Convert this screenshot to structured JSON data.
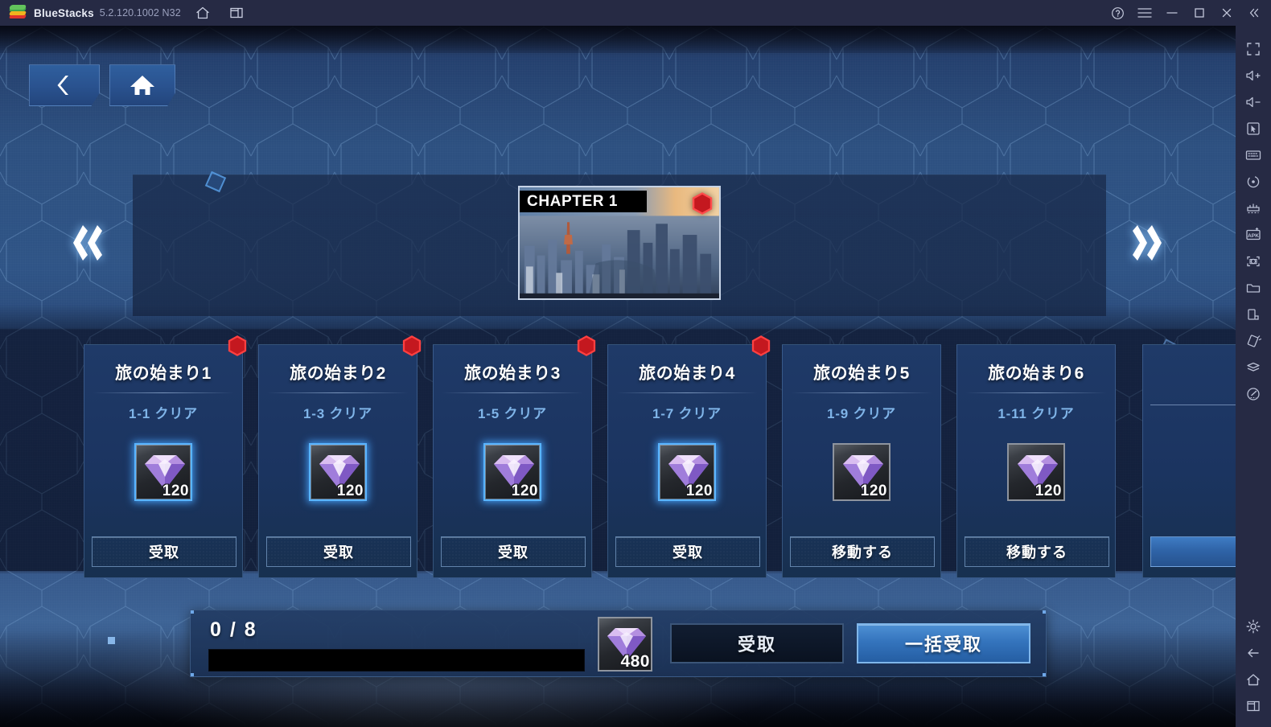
{
  "titlebar": {
    "app_name": "BlueStacks",
    "version": "5.2.120.1002 N32",
    "icons": [
      "bluestacks-logo",
      "home-icon",
      "multi-instance-icon"
    ],
    "right_buttons": [
      "help-icon",
      "menu-icon",
      "minimize-icon",
      "maximize-icon",
      "close-icon",
      "collapse-icon"
    ]
  },
  "sidebar": {
    "top_icons": [
      "fullscreen-icon",
      "volume-up-icon",
      "volume-down-icon",
      "pointer-icon",
      "keyboard-icon",
      "rotate-icon",
      "macro-icon",
      "install-apk-icon",
      "screenshot-icon",
      "media-folder-icon",
      "instance-icon",
      "shake-icon",
      "multi-instance-manager-icon",
      "location-icon"
    ],
    "bottom_icons": [
      "gear-icon",
      "back-arrow-icon",
      "home-icon",
      "recents-icon"
    ]
  },
  "game": {
    "nav": {
      "back_icon": "chevron-left-icon",
      "home_icon": "home-icon",
      "prev_chapter_icon": "double-chevron-left-icon",
      "next_chapter_icon": "double-chevron-right-icon"
    },
    "chapter": {
      "label": "CHAPTER 1",
      "badge": "red-hex-notification"
    },
    "cards": [
      {
        "title": "旅の始まり1",
        "subtitle": "1-1 クリア",
        "reward_qty": "120",
        "button_label": "受取",
        "state": "claimable",
        "highlight": true,
        "badge": true
      },
      {
        "title": "旅の始まり2",
        "subtitle": "1-3 クリア",
        "reward_qty": "120",
        "button_label": "受取",
        "state": "claimable",
        "highlight": true,
        "badge": true
      },
      {
        "title": "旅の始まり3",
        "subtitle": "1-5 クリア",
        "reward_qty": "120",
        "button_label": "受取",
        "state": "claimable",
        "highlight": true,
        "badge": true
      },
      {
        "title": "旅の始まり4",
        "subtitle": "1-7 クリア",
        "reward_qty": "120",
        "button_label": "受取",
        "state": "claimable",
        "highlight": true,
        "badge": true
      },
      {
        "title": "旅の始まり5",
        "subtitle": "1-9 クリア",
        "reward_qty": "120",
        "button_label": "移動する",
        "state": "locked",
        "highlight": false,
        "badge": false
      },
      {
        "title": "旅の始まり6",
        "subtitle": "1-11 クリア",
        "reward_qty": "120",
        "button_label": "移動する",
        "state": "locked",
        "highlight": false,
        "badge": false
      }
    ],
    "footer": {
      "progress_text": "0 / 8",
      "progress_value": 0,
      "progress_max": 8,
      "total_reward_qty": "480",
      "claim_label": "受取",
      "claim_all_label": "一括受取"
    },
    "colors": {
      "accent_blue": "#3f7cc4",
      "highlight_cyan": "#59b4ff",
      "badge_red": "#d8232a",
      "subtitle_blue": "#7fb4e8",
      "card_bg": "#1f3a68"
    }
  }
}
